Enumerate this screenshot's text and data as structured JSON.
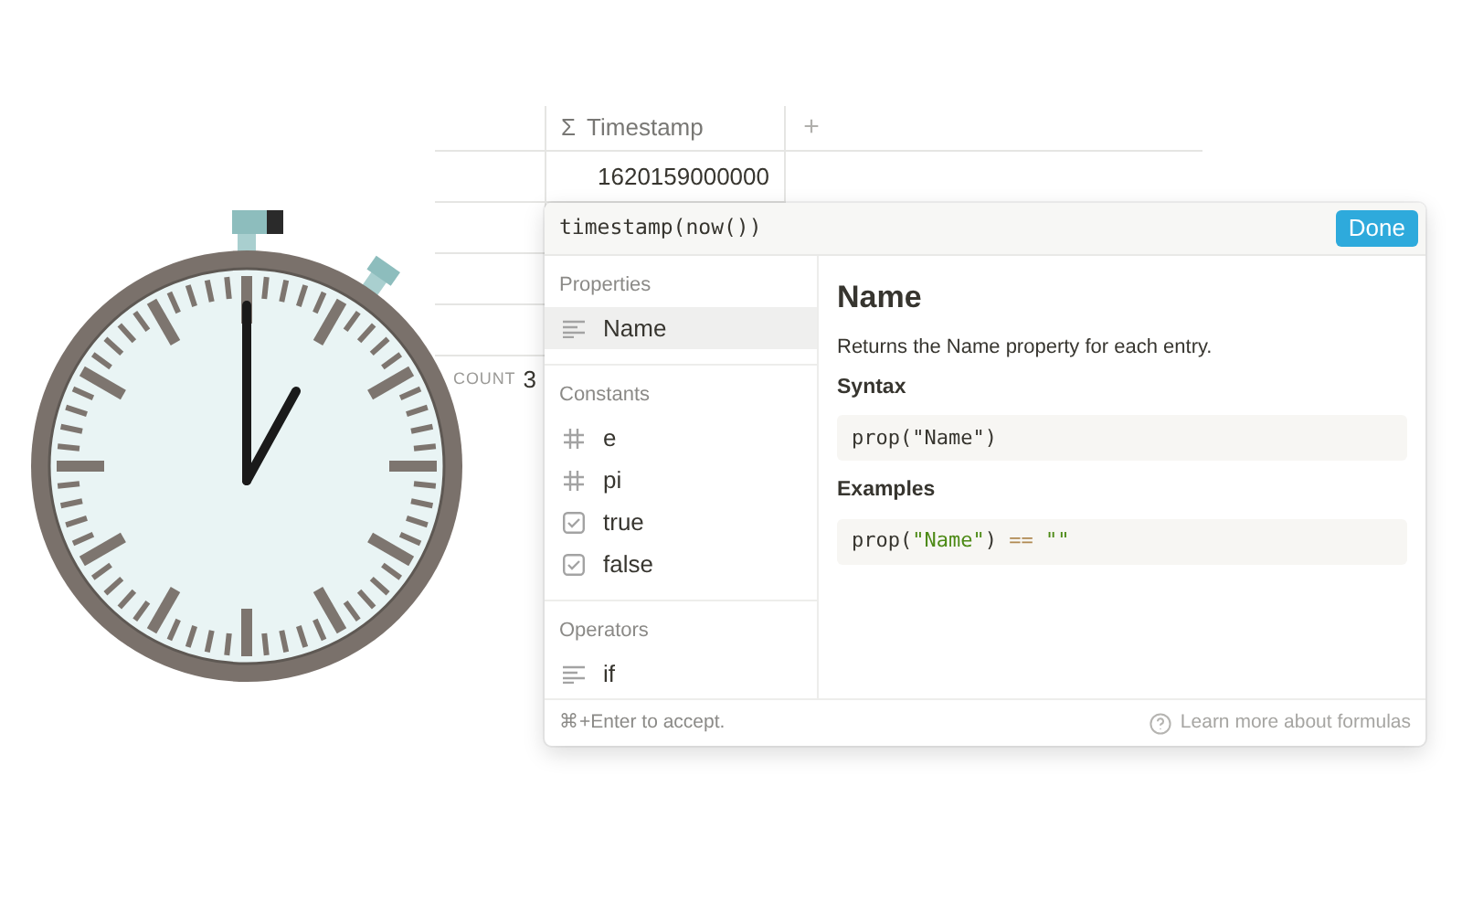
{
  "table": {
    "column": {
      "icon": "Σ",
      "label": "Timestamp"
    },
    "add_button": "+",
    "rows": [
      {
        "value": "1620159000000"
      },
      {
        "value": ""
      },
      {
        "value": ""
      },
      {
        "value": ""
      }
    ],
    "footer": {
      "label": "COUNT",
      "value": "3"
    }
  },
  "formula_editor": {
    "formula": "timestamp(now())",
    "done_button": "Done",
    "sections": [
      {
        "title": "Properties",
        "items": [
          {
            "label": "Name",
            "kind": "text",
            "selected": true
          }
        ]
      },
      {
        "title": "Constants",
        "items": [
          {
            "label": "e",
            "kind": "number",
            "selected": false
          },
          {
            "label": "pi",
            "kind": "number",
            "selected": false
          },
          {
            "label": "true",
            "kind": "checkbox",
            "selected": false
          },
          {
            "label": "false",
            "kind": "checkbox",
            "selected": false
          }
        ]
      },
      {
        "title": "Operators",
        "items": [
          {
            "label": "if",
            "kind": "text",
            "selected": false
          }
        ]
      }
    ],
    "detail": {
      "title": "Name",
      "description": "Returns the Name property for each entry.",
      "syntax_label": "Syntax",
      "syntax": "prop(\"Name\")",
      "examples_label": "Examples",
      "example_tokens": [
        {
          "text": "prop(",
          "kind": "plain"
        },
        {
          "text": "\"Name\"",
          "kind": "string"
        },
        {
          "text": ") ",
          "kind": "plain"
        },
        {
          "text": "==",
          "kind": "operator"
        },
        {
          "text": " \"\"",
          "kind": "string"
        }
      ]
    },
    "footer": {
      "hint": "⌘+Enter to accept.",
      "link": "Learn more about formulas"
    }
  }
}
